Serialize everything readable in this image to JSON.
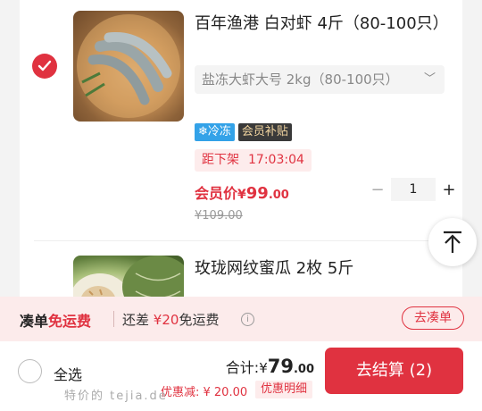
{
  "product1": {
    "title": "百年渔港 白对虾 4斤（80-100只）",
    "spec": "盐冻大虾大号 2kg（80-100只）",
    "tag_frozen": "❄冷冻",
    "tag_member": "会员补贴",
    "countdown_label": "距下架",
    "countdown_time": "17:03:04",
    "member_price_label": "会员价",
    "member_price_currency": "¥",
    "member_price_int": "99",
    "member_price_dec": ".00",
    "original_price": "¥109.00",
    "quantity": "1",
    "minus": "−",
    "plus": "+",
    "selected": true
  },
  "product2": {
    "title": "玫珑网纹蜜瓜 2枚 5斤"
  },
  "promo": {
    "title_prefix": "凑单",
    "title_red": "免运费",
    "remaining_prefix": "还差",
    "remaining_amount": "¥20",
    "remaining_suffix": "免运费",
    "info_icon": "i",
    "action": "去凑单"
  },
  "footer": {
    "select_all": "全选",
    "total_label": "合计:",
    "total_currency": "¥",
    "total_int": "79",
    "total_dec": ".00",
    "discount": "优惠减: ¥ 20.00",
    "discount_detail": "优惠明细",
    "checkout": "去结算 (2)"
  },
  "watermark": "特价的 tejia.de",
  "colors": {
    "accent": "#e03240",
    "frozen_tag": "#33a2e8",
    "member_tag": "#3a3a3a"
  }
}
